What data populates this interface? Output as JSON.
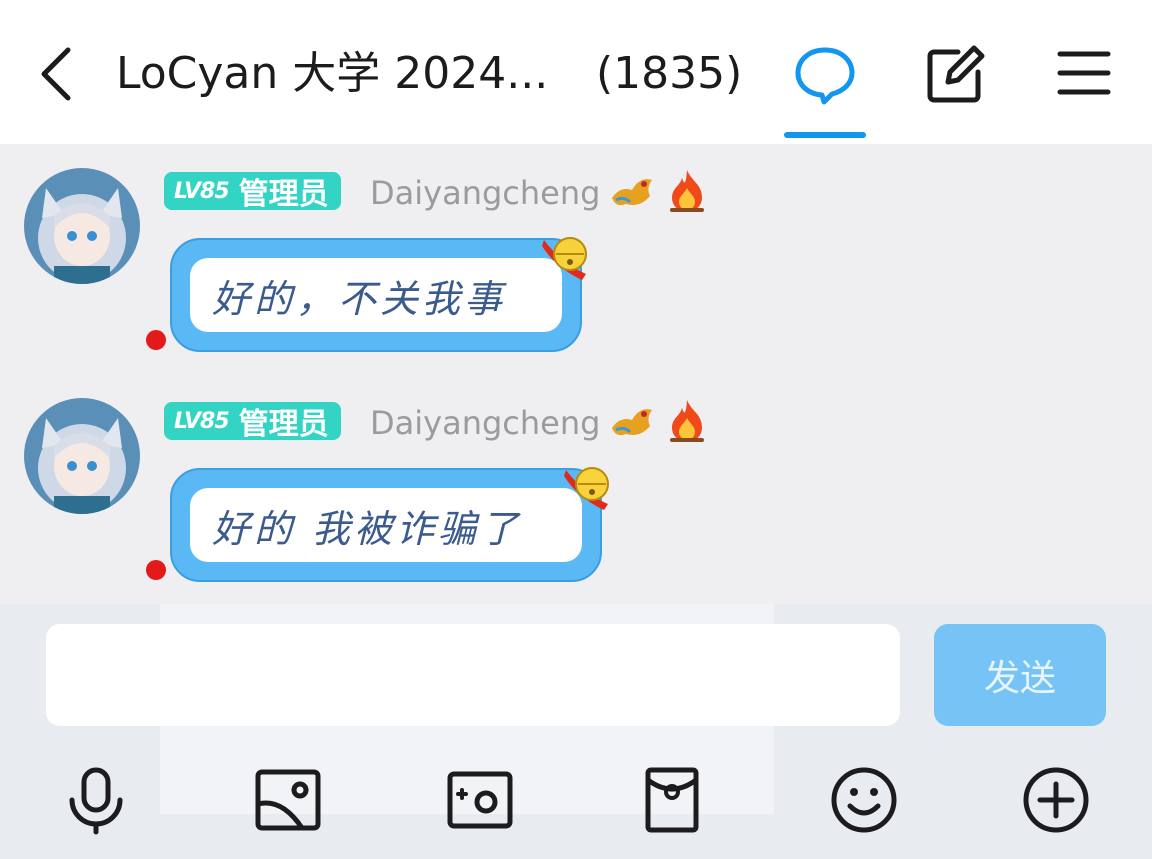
{
  "header": {
    "title": "LoCyan 大学 2024...",
    "member_count": "(1835)",
    "icons": [
      "back-icon",
      "chat-bubble-icon",
      "edit-icon",
      "menu-icon"
    ],
    "accent_color": "#1296f0"
  },
  "messages": [
    {
      "level": "LV85",
      "role": "管理员",
      "nickname": "Daiyangcheng",
      "text": "好的，不关我事"
    },
    {
      "level": "LV85",
      "role": "管理员",
      "nickname": "Daiyangcheng",
      "text": "好的 我被诈骗了"
    }
  ],
  "composer": {
    "input_value": "",
    "send_label": "发送"
  },
  "toolbar": {
    "icons": [
      "microphone-icon",
      "image-icon",
      "camera-icon",
      "red-packet-icon",
      "emoji-icon",
      "plus-icon"
    ]
  }
}
